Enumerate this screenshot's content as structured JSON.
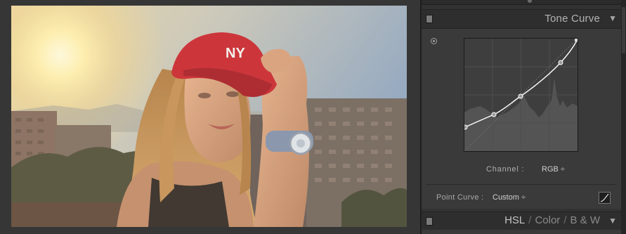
{
  "photo": {
    "image": "sunset-portrait-woman-red-cap",
    "cap_logo": "NY"
  },
  "panel": {
    "tone_curve": {
      "title": "Tone Curve",
      "collapse_icon": "triangle-down-icon",
      "target_icon": "targeted-adjustment-icon",
      "channel_label": "Channel :",
      "channel_value": "RGB ÷",
      "point_curve_label": "Point Curve :",
      "point_curve_value": "Custom ÷",
      "edit_points_icon": "curve-edit-icon"
    },
    "hsl": {
      "tabs": [
        "HSL",
        "Color",
        "B & W"
      ],
      "active_tab": "HSL",
      "collapse_icon": "triangle-down-icon"
    }
  },
  "colors": {
    "panel_bg": "#323232",
    "curve_line": "#ffffff",
    "cap_red": "#c8202c"
  }
}
